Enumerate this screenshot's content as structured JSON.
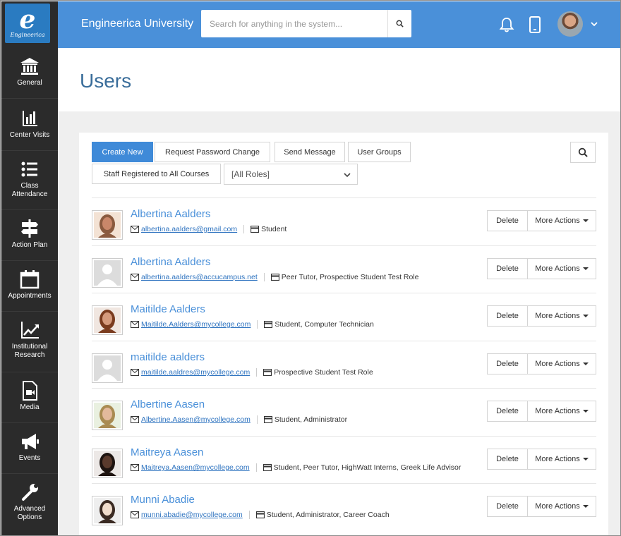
{
  "app": {
    "title": "Engineerica University",
    "logo_letter": "e",
    "logo_text": "Engineerica"
  },
  "search": {
    "placeholder": "Search for anything in the system..."
  },
  "sidebar": {
    "items": [
      {
        "label": "General",
        "icon": "bank-icon"
      },
      {
        "label": "Center Visits",
        "icon": "bar-chart-icon"
      },
      {
        "label": "Class Attendance",
        "icon": "list-icon"
      },
      {
        "label": "Action Plan",
        "icon": "signpost-icon"
      },
      {
        "label": "Appointments",
        "icon": "calendar-icon"
      },
      {
        "label": "Institutional Research",
        "icon": "line-chart-icon"
      },
      {
        "label": "Media",
        "icon": "video-file-icon"
      },
      {
        "label": "Events",
        "icon": "megaphone-icon"
      },
      {
        "label": "Advanced Options",
        "icon": "wrench-icon"
      }
    ]
  },
  "page": {
    "title": "Users"
  },
  "toolbar": {
    "create_new": "Create New",
    "request_password_change": "Request Password Change",
    "send_message": "Send Message",
    "user_groups": "User Groups",
    "staff_registered": "Staff Registered to All Courses",
    "roles_select": "[All Roles]"
  },
  "row_actions": {
    "delete": "Delete",
    "more": "More Actions"
  },
  "users": [
    {
      "name": "Albertina Aalders",
      "email": "albertina.aalders@gmail.com",
      "roles": "Student",
      "photo": "photo"
    },
    {
      "name": "Albertina Aalders",
      "email": "albertina.aalders@accucampus.net",
      "roles": "Peer Tutor, Prospective Student Test Role",
      "photo": "placeholder"
    },
    {
      "name": "Maitilde Aalders",
      "email": "Maitilde.Aalders@mycollege.com",
      "roles": "Student, Computer Technician",
      "photo": "photo"
    },
    {
      "name": "maitilde aalders",
      "email": "maitilde.aaldres@mycollege.com",
      "roles": "Prospective Student Test Role",
      "photo": "placeholder"
    },
    {
      "name": "Albertine Aasen",
      "email": "Albertine.Aasen@mycollege.com",
      "roles": "Student, Administrator",
      "photo": "photo"
    },
    {
      "name": "Maitreya Aasen",
      "email": "Maitreya.Aasen@mycollege.com",
      "roles": "Student, Peer Tutor, HighWatt Interns, Greek Life Advisor",
      "photo": "photo"
    },
    {
      "name": "Munni Abadie",
      "email": "munni.abadie@mycollege.com",
      "roles": "Student, Administrator, Career Coach",
      "photo": "photo"
    }
  ],
  "colors": {
    "topbar": "#4a90d9",
    "sidebar": "#2b2b2b",
    "primary_button": "#3f8ad8",
    "link": "#2f74c0"
  }
}
